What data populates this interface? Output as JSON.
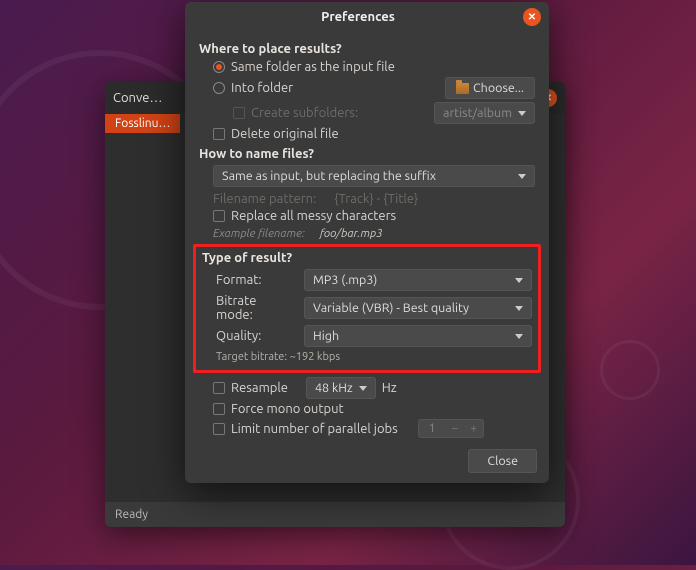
{
  "bg_window": {
    "title": "Conve…",
    "tab": "Fosslinu…",
    "status": "Ready"
  },
  "dialog": {
    "title": "Preferences",
    "section_place": "Where to place results?",
    "opt_same_folder": "Same folder as the input file",
    "opt_into_folder": "Into folder",
    "choose_btn": "Choose...",
    "create_subfolders": "Create subfolders:",
    "subfolder_pattern": "artist/album",
    "delete_original": "Delete original file",
    "section_name": "How to name files?",
    "naming_select": "Same as input, but replacing the suffix",
    "filename_pattern_label": "Filename pattern:",
    "filename_pattern_value": "{Track} - {Title}",
    "replace_messy": "Replace all messy characters",
    "example_label": "Example filename:",
    "example_value": "foo/bar.mp3",
    "section_type": "Type of result?",
    "format_label": "Format:",
    "format_value": "MP3 (.mp3)",
    "bitrate_mode_label": "Bitrate mode:",
    "bitrate_mode_value": "Variable (VBR) - Best quality",
    "quality_label": "Quality:",
    "quality_value": "High",
    "target_bitrate": "Target bitrate: ~192 kbps",
    "resample_label": "Resample",
    "resample_value": "48 kHz",
    "resample_unit": "Hz",
    "force_mono": "Force mono output",
    "limit_jobs": "Limit number of parallel jobs",
    "limit_jobs_value": "1",
    "close_btn": "Close"
  }
}
